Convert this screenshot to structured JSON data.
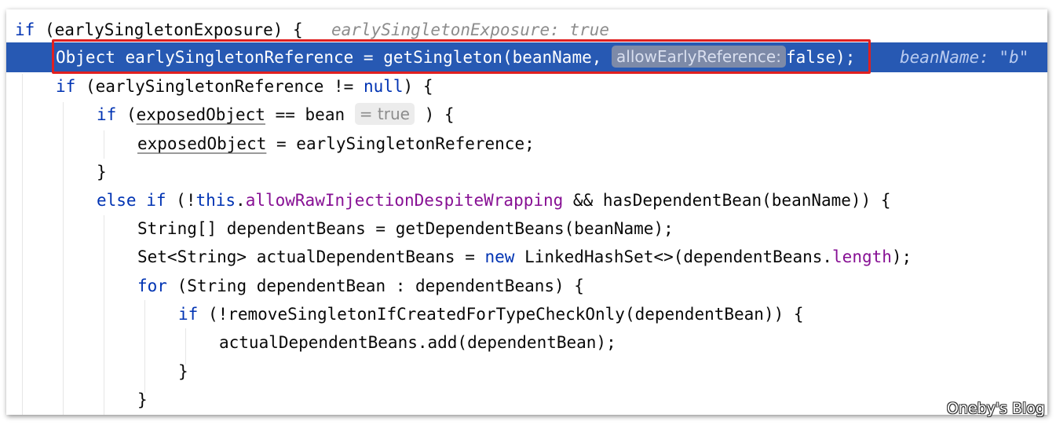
{
  "editor": {
    "line1": {
      "kw_if": "if",
      "cond": " (earlySingletonExposure) {",
      "hint": "earlySingletonExposure: true"
    },
    "line2": {
      "pre": "Object earlySingletonReference = getSingleton(beanName, ",
      "param_hint": "allowEarlyReference:",
      "post": "false);",
      "hint": "beanName: \"b\""
    },
    "line3": {
      "kw_if": "if",
      "pre": " (earlySingletonReference != ",
      "kw_null": "null",
      "post": ") {"
    },
    "line4": {
      "kw_if": "if",
      "pre": " (",
      "var": "exposedObject",
      "mid": " == bean",
      "value_hint": "= true",
      "post": " ) {"
    },
    "line5": {
      "var": "exposedObject",
      "post": " = earlySingletonReference;"
    },
    "line6": {
      "text": "}"
    },
    "line7": {
      "kw_else": "else",
      "kw_if": "if",
      "pre": " (!",
      "kw_this": "this",
      "dot": ".",
      "field": "allowRawInjectionDespiteWrapping",
      "post": " && hasDependentBean(beanName)) {"
    },
    "line8": {
      "text": "String[] dependentBeans = getDependentBeans(beanName);"
    },
    "line9": {
      "pre": "Set<String> actualDependentBeans = ",
      "kw_new": "new",
      "mid": " LinkedHashSet<>(dependentBeans.",
      "field": "length",
      "post": ");"
    },
    "line10": {
      "kw_for": "for",
      "post": " (String dependentBean : dependentBeans) {"
    },
    "line11": {
      "kw_if": "if",
      "post": " (!removeSingletonIfCreatedForTypeCheckOnly(dependentBean)) {"
    },
    "line12": {
      "text": "actualDependentBeans.add(dependentBean);"
    },
    "line13": {
      "text": "}"
    },
    "line14": {
      "text": "}"
    }
  },
  "watermark": "Oneby's Blog",
  "colors": {
    "keyword": "#0033b3",
    "field": "#871094",
    "highlight": "#2759b3",
    "annotation_box": "#e02020"
  }
}
